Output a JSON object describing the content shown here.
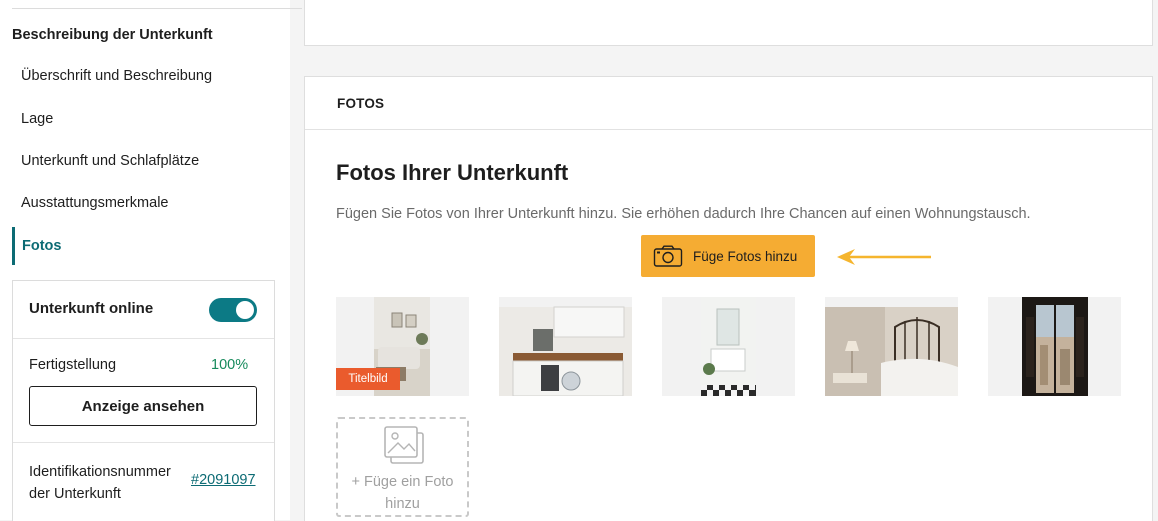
{
  "sidebar": {
    "section_title": "Beschreibung der Unterkunft",
    "items": [
      {
        "label": "Überschrift und Beschreibung"
      },
      {
        "label": "Lage"
      },
      {
        "label": "Unterkunft und Schlafplätze"
      },
      {
        "label": "Ausstattungsmerkmale"
      },
      {
        "label": "Fotos"
      }
    ],
    "status_panel": {
      "online_label": "Unterkunft online",
      "online_toggle": true,
      "completion_label": "Fertigstellung",
      "completion_value": "100%",
      "view_button": "Anzeige ansehen",
      "id_label": "Identifikationsnummer der Unterkunft",
      "id_value": "#2091097"
    }
  },
  "photos_card": {
    "header": "FOTOS",
    "title": "Fotos Ihrer Unterkunft",
    "description": "Fügen Sie Fotos von Ihrer Unterkunft hinzu. Sie erhöhen dadurch Ihre Chancen auf einen Wohnungstausch.",
    "add_button": "Füge Fotos hinzu",
    "cover_badge": "Titelbild",
    "add_tile_label": "+ Füge ein Foto hinzu",
    "arrow_color": "#f5b52e",
    "accent_color": "#f5ac33",
    "icons": [
      "camera-icon",
      "image-placeholder-icon"
    ]
  }
}
